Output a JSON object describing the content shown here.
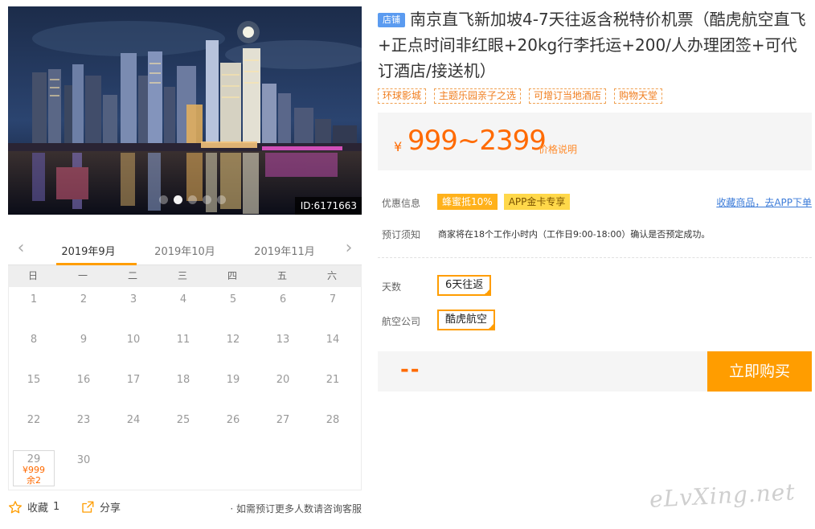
{
  "hero": {
    "id_label": "ID:6171663",
    "slide_count": 5,
    "active_slide": 2
  },
  "calendar": {
    "months": [
      "2019年9月",
      "2019年10月",
      "2019年11月"
    ],
    "active_month": "2019年9月",
    "weekdays": [
      "日",
      "一",
      "二",
      "三",
      "四",
      "五",
      "六"
    ],
    "days": [
      "1",
      "2",
      "3",
      "4",
      "5",
      "6",
      "7",
      "8",
      "9",
      "10",
      "11",
      "12",
      "13",
      "14",
      "15",
      "16",
      "17",
      "18",
      "19",
      "20",
      "21",
      "22",
      "23",
      "24",
      "25",
      "26",
      "27",
      "28",
      "29",
      "30"
    ],
    "available": {
      "day": "29",
      "price": "¥999",
      "remaining": "余2"
    }
  },
  "footer": {
    "favorite_label": "收藏",
    "favorite_count": "1",
    "share_label": "分享",
    "hint": "· 如需预订更多人数请咨询客服"
  },
  "product": {
    "shop_badge": "店铺",
    "title": "南京直飞新加坡4-7天往返含税特价机票（酷虎航空直飞+正点时间非红眼+20kg行李托运+200/人办理团签+可代订酒店/接送机）",
    "tags": [
      "环球影城",
      "主题乐园亲子之选",
      "可增订当地酒店",
      "购物天堂"
    ],
    "currency": "¥",
    "price_range": "999~2399",
    "price_explain": "价格说明",
    "discount_label": "优惠信息",
    "discounts": [
      "蜂蜜抵10%",
      "APP金卡专享"
    ],
    "app_link": "收藏商品，去APP下单",
    "notice_label": "预订须知",
    "notice_text": "商家将在18个工作小时内（工作日9:00-18:00）确认是否预定成功。",
    "days_label": "天数",
    "days_option": "6天往返",
    "airline_label": "航空公司",
    "airline_option": "酷虎航空",
    "total": "--",
    "buy_label": "立即购买"
  },
  "watermark": "eLvXing.net",
  "colors": {
    "accent": "#ff9d00",
    "price": "#ff6a00",
    "link": "#3b7bd8",
    "badge": "#5b9bf0"
  }
}
